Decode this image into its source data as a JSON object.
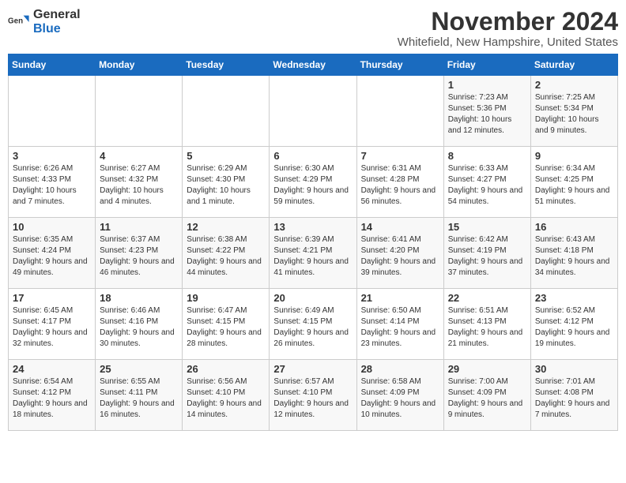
{
  "header": {
    "logo_general": "General",
    "logo_blue": "Blue",
    "month_title": "November 2024",
    "location": "Whitefield, New Hampshire, United States"
  },
  "weekdays": [
    "Sunday",
    "Monday",
    "Tuesday",
    "Wednesday",
    "Thursday",
    "Friday",
    "Saturday"
  ],
  "weeks": [
    [
      {
        "day": "",
        "info": ""
      },
      {
        "day": "",
        "info": ""
      },
      {
        "day": "",
        "info": ""
      },
      {
        "day": "",
        "info": ""
      },
      {
        "day": "",
        "info": ""
      },
      {
        "day": "1",
        "info": "Sunrise: 7:23 AM\nSunset: 5:36 PM\nDaylight: 10 hours and 12 minutes."
      },
      {
        "day": "2",
        "info": "Sunrise: 7:25 AM\nSunset: 5:34 PM\nDaylight: 10 hours and 9 minutes."
      }
    ],
    [
      {
        "day": "3",
        "info": "Sunrise: 6:26 AM\nSunset: 4:33 PM\nDaylight: 10 hours and 7 minutes."
      },
      {
        "day": "4",
        "info": "Sunrise: 6:27 AM\nSunset: 4:32 PM\nDaylight: 10 hours and 4 minutes."
      },
      {
        "day": "5",
        "info": "Sunrise: 6:29 AM\nSunset: 4:30 PM\nDaylight: 10 hours and 1 minute."
      },
      {
        "day": "6",
        "info": "Sunrise: 6:30 AM\nSunset: 4:29 PM\nDaylight: 9 hours and 59 minutes."
      },
      {
        "day": "7",
        "info": "Sunrise: 6:31 AM\nSunset: 4:28 PM\nDaylight: 9 hours and 56 minutes."
      },
      {
        "day": "8",
        "info": "Sunrise: 6:33 AM\nSunset: 4:27 PM\nDaylight: 9 hours and 54 minutes."
      },
      {
        "day": "9",
        "info": "Sunrise: 6:34 AM\nSunset: 4:25 PM\nDaylight: 9 hours and 51 minutes."
      }
    ],
    [
      {
        "day": "10",
        "info": "Sunrise: 6:35 AM\nSunset: 4:24 PM\nDaylight: 9 hours and 49 minutes."
      },
      {
        "day": "11",
        "info": "Sunrise: 6:37 AM\nSunset: 4:23 PM\nDaylight: 9 hours and 46 minutes."
      },
      {
        "day": "12",
        "info": "Sunrise: 6:38 AM\nSunset: 4:22 PM\nDaylight: 9 hours and 44 minutes."
      },
      {
        "day": "13",
        "info": "Sunrise: 6:39 AM\nSunset: 4:21 PM\nDaylight: 9 hours and 41 minutes."
      },
      {
        "day": "14",
        "info": "Sunrise: 6:41 AM\nSunset: 4:20 PM\nDaylight: 9 hours and 39 minutes."
      },
      {
        "day": "15",
        "info": "Sunrise: 6:42 AM\nSunset: 4:19 PM\nDaylight: 9 hours and 37 minutes."
      },
      {
        "day": "16",
        "info": "Sunrise: 6:43 AM\nSunset: 4:18 PM\nDaylight: 9 hours and 34 minutes."
      }
    ],
    [
      {
        "day": "17",
        "info": "Sunrise: 6:45 AM\nSunset: 4:17 PM\nDaylight: 9 hours and 32 minutes."
      },
      {
        "day": "18",
        "info": "Sunrise: 6:46 AM\nSunset: 4:16 PM\nDaylight: 9 hours and 30 minutes."
      },
      {
        "day": "19",
        "info": "Sunrise: 6:47 AM\nSunset: 4:15 PM\nDaylight: 9 hours and 28 minutes."
      },
      {
        "day": "20",
        "info": "Sunrise: 6:49 AM\nSunset: 4:15 PM\nDaylight: 9 hours and 26 minutes."
      },
      {
        "day": "21",
        "info": "Sunrise: 6:50 AM\nSunset: 4:14 PM\nDaylight: 9 hours and 23 minutes."
      },
      {
        "day": "22",
        "info": "Sunrise: 6:51 AM\nSunset: 4:13 PM\nDaylight: 9 hours and 21 minutes."
      },
      {
        "day": "23",
        "info": "Sunrise: 6:52 AM\nSunset: 4:12 PM\nDaylight: 9 hours and 19 minutes."
      }
    ],
    [
      {
        "day": "24",
        "info": "Sunrise: 6:54 AM\nSunset: 4:12 PM\nDaylight: 9 hours and 18 minutes."
      },
      {
        "day": "25",
        "info": "Sunrise: 6:55 AM\nSunset: 4:11 PM\nDaylight: 9 hours and 16 minutes."
      },
      {
        "day": "26",
        "info": "Sunrise: 6:56 AM\nSunset: 4:10 PM\nDaylight: 9 hours and 14 minutes."
      },
      {
        "day": "27",
        "info": "Sunrise: 6:57 AM\nSunset: 4:10 PM\nDaylight: 9 hours and 12 minutes."
      },
      {
        "day": "28",
        "info": "Sunrise: 6:58 AM\nSunset: 4:09 PM\nDaylight: 9 hours and 10 minutes."
      },
      {
        "day": "29",
        "info": "Sunrise: 7:00 AM\nSunset: 4:09 PM\nDaylight: 9 hours and 9 minutes."
      },
      {
        "day": "30",
        "info": "Sunrise: 7:01 AM\nSunset: 4:08 PM\nDaylight: 9 hours and 7 minutes."
      }
    ]
  ]
}
